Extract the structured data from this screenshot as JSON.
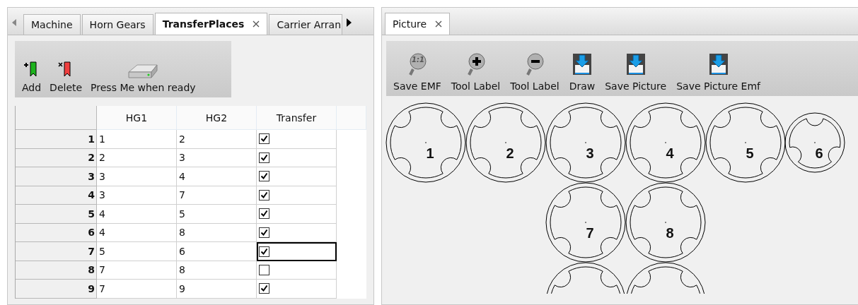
{
  "left_panel": {
    "tabs": [
      {
        "label": "Machine",
        "selected": false,
        "closable": false
      },
      {
        "label": "Horn Gears",
        "selected": false,
        "closable": false
      },
      {
        "label": "TransferPlaces",
        "selected": true,
        "closable": true
      },
      {
        "label": "Carrier Arran",
        "selected": false,
        "closable": false
      }
    ],
    "toolbar": [
      {
        "kind": "add",
        "label": "Add"
      },
      {
        "kind": "delete",
        "label": "Delete"
      },
      {
        "kind": "drive",
        "label": "Press Me when ready"
      }
    ],
    "table": {
      "columns": [
        "HG1",
        "HG2",
        "Transfer"
      ],
      "rows": [
        {
          "index": "1",
          "hg1": "1",
          "hg2": "2",
          "transfer": true,
          "focused": false
        },
        {
          "index": "2",
          "hg1": "2",
          "hg2": "3",
          "transfer": true,
          "focused": false
        },
        {
          "index": "3",
          "hg1": "3",
          "hg2": "4",
          "transfer": true,
          "focused": false
        },
        {
          "index": "4",
          "hg1": "3",
          "hg2": "7",
          "transfer": true,
          "focused": false
        },
        {
          "index": "5",
          "hg1": "4",
          "hg2": "5",
          "transfer": true,
          "focused": false
        },
        {
          "index": "6",
          "hg1": "4",
          "hg2": "8",
          "transfer": true,
          "focused": false
        },
        {
          "index": "7",
          "hg1": "5",
          "hg2": "6",
          "transfer": true,
          "focused": true
        },
        {
          "index": "8",
          "hg1": "7",
          "hg2": "8",
          "transfer": false,
          "focused": false
        },
        {
          "index": "9",
          "hg1": "7",
          "hg2": "9",
          "transfer": true,
          "focused": false
        }
      ]
    }
  },
  "right_panel": {
    "tabs": [
      {
        "label": "Picture",
        "selected": true,
        "closable": true
      }
    ],
    "toolbar": [
      {
        "kind": "zoom-reset",
        "glyph": "1:1",
        "label": "Save EMF"
      },
      {
        "kind": "zoom-in",
        "label": "Tool Label"
      },
      {
        "kind": "zoom-out",
        "label": "Tool Label"
      },
      {
        "kind": "save",
        "label": "Draw"
      },
      {
        "kind": "save",
        "label": "Save Picture"
      },
      {
        "kind": "save",
        "label": "Save Picture Emf"
      }
    ],
    "gears": [
      {
        "label": "1",
        "kind": "large"
      },
      {
        "label": "2",
        "kind": "large"
      },
      {
        "label": "3",
        "kind": "large"
      },
      {
        "label": "4",
        "kind": "large"
      },
      {
        "label": "5",
        "kind": "large"
      },
      {
        "label": "6",
        "kind": "small"
      },
      {
        "label": "7",
        "kind": "large"
      },
      {
        "label": "8",
        "kind": "large"
      },
      {
        "kind": "large"
      },
      {
        "kind": "large"
      }
    ]
  }
}
